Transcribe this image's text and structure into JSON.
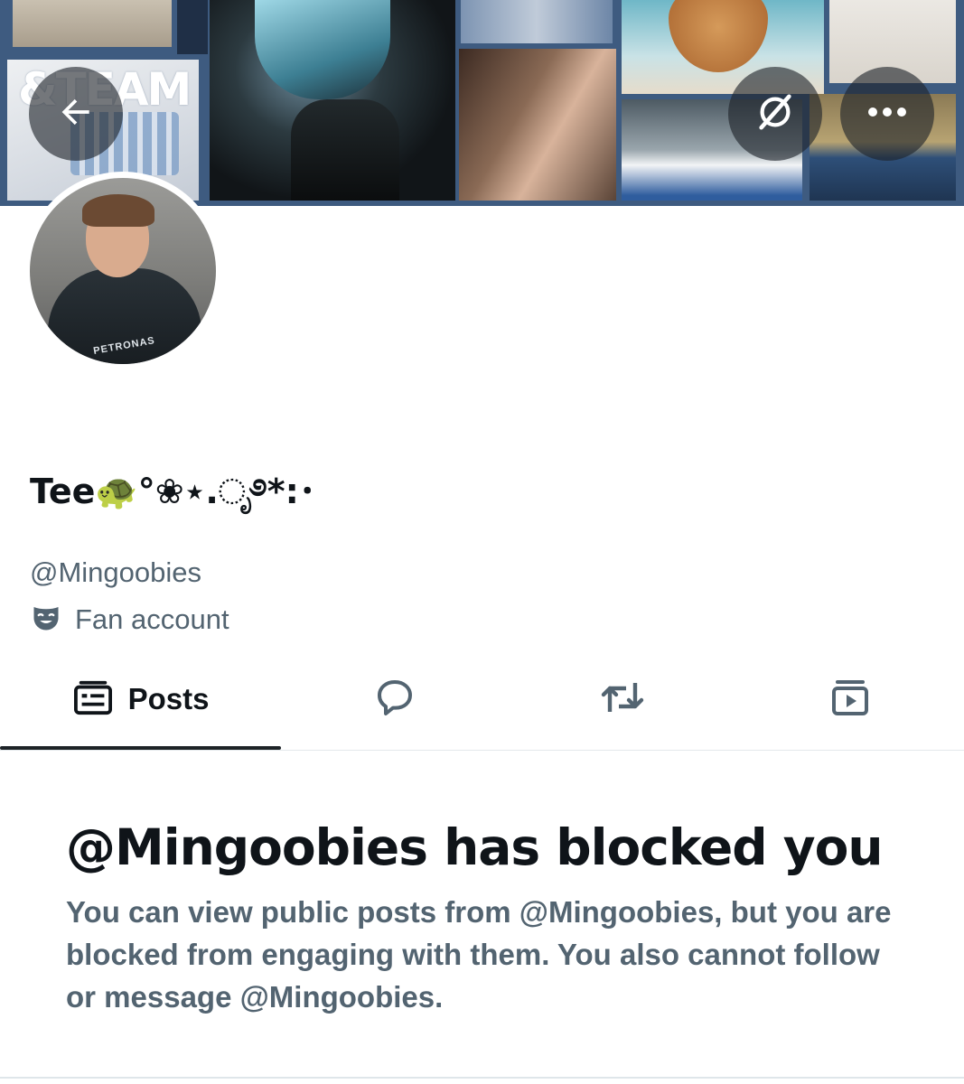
{
  "banner": {
    "collage_text": "&TEAM"
  },
  "header_buttons": {
    "back_icon": "arrow-left-icon",
    "grok_icon": "grok-slash-icon",
    "more_icon": "more-horizontal-icon"
  },
  "avatar": {
    "suit_text": "PETRONAS"
  },
  "profile": {
    "display_name": "Tee🐢°❀⋆.ೃ࿔*:･",
    "handle": "@Mingoobies",
    "category": "Fan account",
    "category_icon": "theater-mask-icon"
  },
  "tabs": [
    {
      "label": "Posts",
      "icon": "posts-icon",
      "active": true
    },
    {
      "label": "",
      "icon": "reply-bubble-icon",
      "active": false
    },
    {
      "label": "",
      "icon": "repost-icon",
      "active": false
    },
    {
      "label": "",
      "icon": "media-play-icon",
      "active": false
    }
  ],
  "block_notice": {
    "title": "@Mingoobies has blocked you",
    "body": "You can view public posts from @Mingoobies, but you are blocked from engaging with them. You also cannot follow or message @Mingoobies."
  },
  "colors": {
    "text_primary": "#0f1419",
    "text_secondary": "#536471",
    "banner_frame": "#3e5b80",
    "tab_underline": "#1d2327"
  }
}
